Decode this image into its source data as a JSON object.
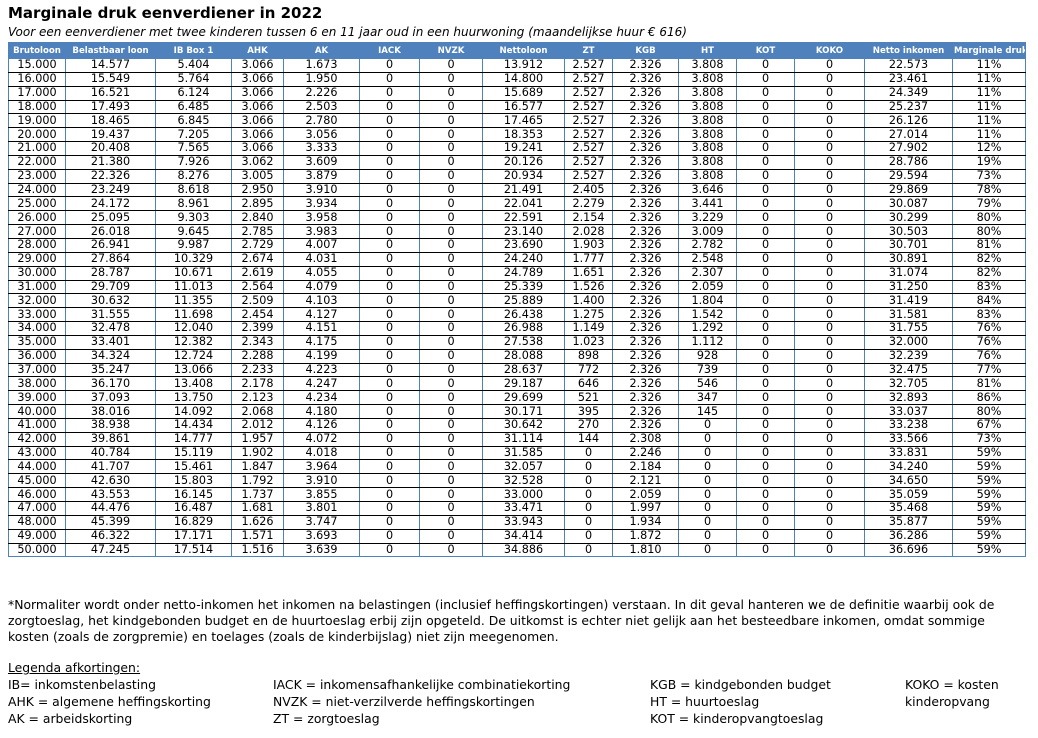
{
  "title": "Marginale druk eenverdiener in 2022",
  "subtitle": "Voor een eenverdiener met twee kinderen tussen 6 en 11 jaar oud in een huurwoning (maandelijkse huur € 616)",
  "columns": [
    "Brutoloon",
    "Belastbaar loon",
    "IB Box 1",
    "AHK",
    "AK",
    "IACK",
    "NVZK",
    "Nettoloon",
    "ZT",
    "KGB",
    "HT",
    "KOT",
    "KOKO",
    "Netto inkomen",
    "Marginale druk"
  ],
  "rows": [
    [
      "15.000",
      "14.577",
      "5.404",
      "3.066",
      "1.673",
      "0",
      "0",
      "13.912",
      "2.527",
      "2.326",
      "3.808",
      "0",
      "0",
      "22.573",
      "11%"
    ],
    [
      "16.000",
      "15.549",
      "5.764",
      "3.066",
      "1.950",
      "0",
      "0",
      "14.800",
      "2.527",
      "2.326",
      "3.808",
      "0",
      "0",
      "23.461",
      "11%"
    ],
    [
      "17.000",
      "16.521",
      "6.124",
      "3.066",
      "2.226",
      "0",
      "0",
      "15.689",
      "2.527",
      "2.326",
      "3.808",
      "0",
      "0",
      "24.349",
      "11%"
    ],
    [
      "18.000",
      "17.493",
      "6.485",
      "3.066",
      "2.503",
      "0",
      "0",
      "16.577",
      "2.527",
      "2.326",
      "3.808",
      "0",
      "0",
      "25.237",
      "11%"
    ],
    [
      "19.000",
      "18.465",
      "6.845",
      "3.066",
      "2.780",
      "0",
      "0",
      "17.465",
      "2.527",
      "2.326",
      "3.808",
      "0",
      "0",
      "26.126",
      "11%"
    ],
    [
      "20.000",
      "19.437",
      "7.205",
      "3.066",
      "3.056",
      "0",
      "0",
      "18.353",
      "2.527",
      "2.326",
      "3.808",
      "0",
      "0",
      "27.014",
      "11%"
    ],
    [
      "21.000",
      "20.408",
      "7.565",
      "3.066",
      "3.333",
      "0",
      "0",
      "19.241",
      "2.527",
      "2.326",
      "3.808",
      "0",
      "0",
      "27.902",
      "12%"
    ],
    [
      "22.000",
      "21.380",
      "7.926",
      "3.062",
      "3.609",
      "0",
      "0",
      "20.126",
      "2.527",
      "2.326",
      "3.808",
      "0",
      "0",
      "28.786",
      "19%"
    ],
    [
      "23.000",
      "22.326",
      "8.276",
      "3.005",
      "3.879",
      "0",
      "0",
      "20.934",
      "2.527",
      "2.326",
      "3.808",
      "0",
      "0",
      "29.594",
      "73%"
    ],
    [
      "24.000",
      "23.249",
      "8.618",
      "2.950",
      "3.910",
      "0",
      "0",
      "21.491",
      "2.405",
      "2.326",
      "3.646",
      "0",
      "0",
      "29.869",
      "78%"
    ],
    [
      "25.000",
      "24.172",
      "8.961",
      "2.895",
      "3.934",
      "0",
      "0",
      "22.041",
      "2.279",
      "2.326",
      "3.441",
      "0",
      "0",
      "30.087",
      "79%"
    ],
    [
      "26.000",
      "25.095",
      "9.303",
      "2.840",
      "3.958",
      "0",
      "0",
      "22.591",
      "2.154",
      "2.326",
      "3.229",
      "0",
      "0",
      "30.299",
      "80%"
    ],
    [
      "27.000",
      "26.018",
      "9.645",
      "2.785",
      "3.983",
      "0",
      "0",
      "23.140",
      "2.028",
      "2.326",
      "3.009",
      "0",
      "0",
      "30.503",
      "80%"
    ],
    [
      "28.000",
      "26.941",
      "9.987",
      "2.729",
      "4.007",
      "0",
      "0",
      "23.690",
      "1.903",
      "2.326",
      "2.782",
      "0",
      "0",
      "30.701",
      "81%"
    ],
    [
      "29.000",
      "27.864",
      "10.329",
      "2.674",
      "4.031",
      "0",
      "0",
      "24.240",
      "1.777",
      "2.326",
      "2.548",
      "0",
      "0",
      "30.891",
      "82%"
    ],
    [
      "30.000",
      "28.787",
      "10.671",
      "2.619",
      "4.055",
      "0",
      "0",
      "24.789",
      "1.651",
      "2.326",
      "2.307",
      "0",
      "0",
      "31.074",
      "82%"
    ],
    [
      "31.000",
      "29.709",
      "11.013",
      "2.564",
      "4.079",
      "0",
      "0",
      "25.339",
      "1.526",
      "2.326",
      "2.059",
      "0",
      "0",
      "31.250",
      "83%"
    ],
    [
      "32.000",
      "30.632",
      "11.355",
      "2.509",
      "4.103",
      "0",
      "0",
      "25.889",
      "1.400",
      "2.326",
      "1.804",
      "0",
      "0",
      "31.419",
      "84%"
    ],
    [
      "33.000",
      "31.555",
      "11.698",
      "2.454",
      "4.127",
      "0",
      "0",
      "26.438",
      "1.275",
      "2.326",
      "1.542",
      "0",
      "0",
      "31.581",
      "83%"
    ],
    [
      "34.000",
      "32.478",
      "12.040",
      "2.399",
      "4.151",
      "0",
      "0",
      "26.988",
      "1.149",
      "2.326",
      "1.292",
      "0",
      "0",
      "31.755",
      "76%"
    ],
    [
      "35.000",
      "33.401",
      "12.382",
      "2.343",
      "4.175",
      "0",
      "0",
      "27.538",
      "1.023",
      "2.326",
      "1.112",
      "0",
      "0",
      "32.000",
      "76%"
    ],
    [
      "36.000",
      "34.324",
      "12.724",
      "2.288",
      "4.199",
      "0",
      "0",
      "28.088",
      "898",
      "2.326",
      "928",
      "0",
      "0",
      "32.239",
      "76%"
    ],
    [
      "37.000",
      "35.247",
      "13.066",
      "2.233",
      "4.223",
      "0",
      "0",
      "28.637",
      "772",
      "2.326",
      "739",
      "0",
      "0",
      "32.475",
      "77%"
    ],
    [
      "38.000",
      "36.170",
      "13.408",
      "2.178",
      "4.247",
      "0",
      "0",
      "29.187",
      "646",
      "2.326",
      "546",
      "0",
      "0",
      "32.705",
      "81%"
    ],
    [
      "39.000",
      "37.093",
      "13.750",
      "2.123",
      "4.234",
      "0",
      "0",
      "29.699",
      "521",
      "2.326",
      "347",
      "0",
      "0",
      "32.893",
      "86%"
    ],
    [
      "40.000",
      "38.016",
      "14.092",
      "2.068",
      "4.180",
      "0",
      "0",
      "30.171",
      "395",
      "2.326",
      "145",
      "0",
      "0",
      "33.037",
      "80%"
    ],
    [
      "41.000",
      "38.938",
      "14.434",
      "2.012",
      "4.126",
      "0",
      "0",
      "30.642",
      "270",
      "2.326",
      "0",
      "0",
      "0",
      "33.238",
      "67%"
    ],
    [
      "42.000",
      "39.861",
      "14.777",
      "1.957",
      "4.072",
      "0",
      "0",
      "31.114",
      "144",
      "2.308",
      "0",
      "0",
      "0",
      "33.566",
      "73%"
    ],
    [
      "43.000",
      "40.784",
      "15.119",
      "1.902",
      "4.018",
      "0",
      "0",
      "31.585",
      "0",
      "2.246",
      "0",
      "0",
      "0",
      "33.831",
      "59%"
    ],
    [
      "44.000",
      "41.707",
      "15.461",
      "1.847",
      "3.964",
      "0",
      "0",
      "32.057",
      "0",
      "2.184",
      "0",
      "0",
      "0",
      "34.240",
      "59%"
    ],
    [
      "45.000",
      "42.630",
      "15.803",
      "1.792",
      "3.910",
      "0",
      "0",
      "32.528",
      "0",
      "2.121",
      "0",
      "0",
      "0",
      "34.650",
      "59%"
    ],
    [
      "46.000",
      "43.553",
      "16.145",
      "1.737",
      "3.855",
      "0",
      "0",
      "33.000",
      "0",
      "2.059",
      "0",
      "0",
      "0",
      "35.059",
      "59%"
    ],
    [
      "47.000",
      "44.476",
      "16.487",
      "1.681",
      "3.801",
      "0",
      "0",
      "33.471",
      "0",
      "1.997",
      "0",
      "0",
      "0",
      "35.468",
      "59%"
    ],
    [
      "48.000",
      "45.399",
      "16.829",
      "1.626",
      "3.747",
      "0",
      "0",
      "33.943",
      "0",
      "1.934",
      "0",
      "0",
      "0",
      "35.877",
      "59%"
    ],
    [
      "49.000",
      "46.322",
      "17.171",
      "1.571",
      "3.693",
      "0",
      "0",
      "34.414",
      "0",
      "1.872",
      "0",
      "0",
      "0",
      "36.286",
      "59%"
    ],
    [
      "50.000",
      "47.245",
      "17.514",
      "1.516",
      "3.639",
      "0",
      "0",
      "34.886",
      "0",
      "1.810",
      "0",
      "0",
      "0",
      "36.696",
      "59%"
    ]
  ],
  "footnote": "*Normaliter wordt onder netto-inkomen het inkomen na belastingen (inclusief heffingskortingen) verstaan. In dit geval hanteren we de definitie waarbij ook de zorgtoeslag, het kindgebonden budget en de huurtoeslag erbij zijn opgeteld. De uitkomst is echter niet gelijk aan het besteedbare inkomen, omdat sommige kosten (zoals de zorgpremie) en toelages (zoals de kinderbijslag) niet zijn meegenomen.",
  "legend": {
    "title": "Legenda afkortingen",
    "colon": ":",
    "col1": [
      "IB= inkomstenbelasting",
      "AHK = algemene heffingskorting",
      "AK = arbeidskorting"
    ],
    "col2": [
      "IACK = inkomensafhankelijke combinatiekorting",
      "NVZK = niet-verzilverde heffingskortingen",
      "ZT = zorgtoeslag"
    ],
    "col3": [
      "KGB = kindgebonden budget",
      "HT = huurtoeslag",
      "KOT = kinderopvangtoeslag"
    ],
    "col4": [
      "KOKO = kosten",
      "kinderopvang"
    ]
  }
}
